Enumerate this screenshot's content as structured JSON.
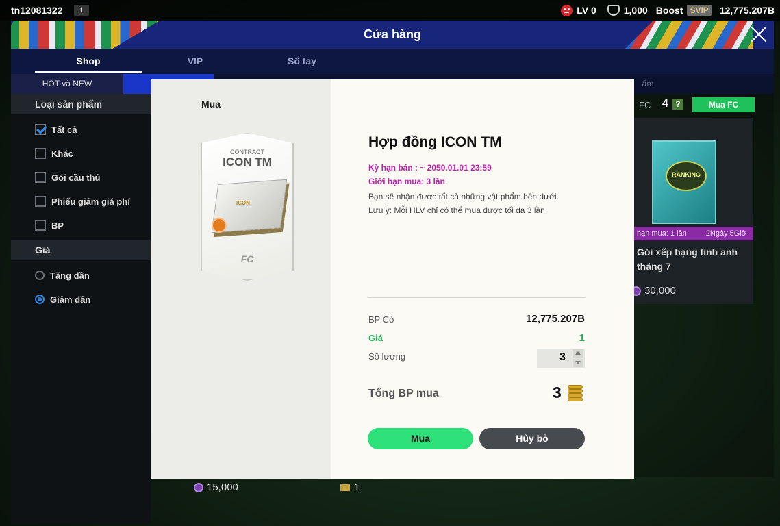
{
  "topbar": {
    "user_id": "tn12081322",
    "level_badge": "1",
    "lv": "LV 0",
    "points": "1,000",
    "boost": "Boost",
    "svip": "SVIP",
    "bp": "12,775.207B"
  },
  "header": {
    "title": "Cửa hàng"
  },
  "tabs": [
    {
      "label": "Shop"
    },
    {
      "label": "VIP"
    },
    {
      "label": "Sổ tay"
    }
  ],
  "subtabs": {
    "hot": "HOT và NEW",
    "right": "ấm"
  },
  "sidebar": {
    "product_type_header": "Loại sản phẩm",
    "product_types": [
      {
        "label": "Tất cả",
        "checked": true
      },
      {
        "label": "Khác",
        "checked": false
      },
      {
        "label": "Gói cầu thủ",
        "checked": false
      },
      {
        "label": "Phiếu giảm giá phí",
        "checked": false
      },
      {
        "label": "BP",
        "checked": false
      }
    ],
    "price_header": "Giá",
    "price_sorts": [
      {
        "label": "Tăng dần",
        "selected": false
      },
      {
        "label": "Giảm dần",
        "selected": true
      }
    ]
  },
  "background_card": {
    "fc_label": "FC",
    "fc_count": "4",
    "help": "?",
    "buy_fc": "Mua FC",
    "pack_badge": "RANKING",
    "limit": "hạn mua: 1 lần",
    "time_left": "2Ngày 5Giờ",
    "name": "Gói xếp hạng tinh anh tháng 7",
    "price": "30,000"
  },
  "background_prices": {
    "left": "15,000",
    "right": "1"
  },
  "modal": {
    "left_title": "Mua",
    "card_label": "CONTRACT",
    "card_title": "ICON TM",
    "card_board_text": "ICON",
    "card_logo": "FC",
    "item_title": "Hợp đồng ICON TM",
    "sale_period": "Kỳ hạn bán : ~ 2050.01.01 23:59",
    "purchase_limit": "Giới hạn mua: 3 lần",
    "desc_1": "Bạn sẽ nhận được tất cả những vật phẩm bên dưới.",
    "desc_2": "Lưu ý: Mỗi HLV chỉ có thể mua được tối đa 3 lần.",
    "bp_label": "BP Có",
    "bp_value": "12,775.207B",
    "price_label": "Giá",
    "price_value": "1",
    "qty_label": "Số lượng",
    "qty_value": "3",
    "total_label": "Tổng BP mua",
    "total_value": "3",
    "buy_button": "Mua",
    "cancel_button": "Hủy bỏ"
  },
  "colors": {
    "accent_green": "#2ee07a",
    "limit_magenta": "#c01fb1",
    "header_blue": "#17267a",
    "active_blue": "#2f8ae8"
  }
}
